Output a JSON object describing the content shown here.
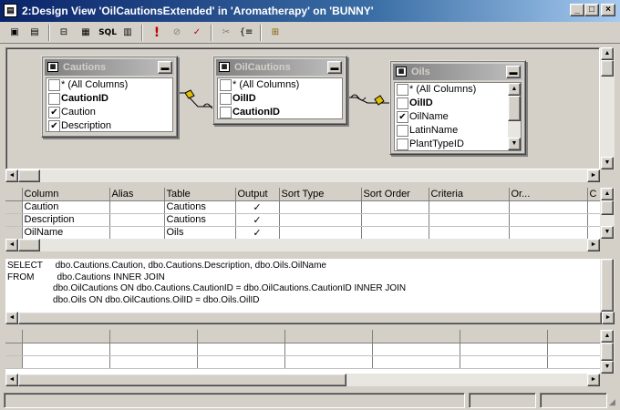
{
  "window": {
    "title": "2:Design View 'OilCautionsExtended' in 'Aromatherapy' on 'BUNNY'",
    "controls": [
      "_",
      "□",
      "×"
    ]
  },
  "toolbar": {
    "items": [
      {
        "name": "save-icon",
        "glyph": "▣"
      },
      {
        "name": "properties-icon",
        "glyph": "▤"
      },
      {
        "name": "diagram-pane-icon",
        "glyph": "⊟"
      },
      {
        "name": "grid-pane-icon",
        "glyph": "▦"
      },
      {
        "name": "sql-pane-icon",
        "glyph": "SQL"
      },
      {
        "name": "results-pane-icon",
        "glyph": "▥"
      },
      {
        "name": "run-icon",
        "glyph": "!"
      },
      {
        "name": "cancel-query-icon",
        "glyph": "⊘"
      },
      {
        "name": "verify-sql-icon",
        "glyph": "✓"
      },
      {
        "name": "remove-filter-icon",
        "glyph": "✂"
      },
      {
        "name": "group-by-icon",
        "glyph": "{≡"
      },
      {
        "name": "add-table-icon",
        "glyph": "⊞"
      }
    ]
  },
  "diagram": {
    "tables": [
      {
        "name": "Cautions",
        "fields": [
          {
            "label": "* (All Columns)",
            "checked": false,
            "bold": false
          },
          {
            "label": "CautionID",
            "checked": false,
            "bold": true
          },
          {
            "label": "Caution",
            "checked": true,
            "bold": false
          },
          {
            "label": "Description",
            "checked": true,
            "bold": false
          }
        ]
      },
      {
        "name": "OilCautions",
        "fields": [
          {
            "label": "* (All Columns)",
            "checked": false,
            "bold": false
          },
          {
            "label": "OilID",
            "checked": false,
            "bold": true
          },
          {
            "label": "CautionID",
            "checked": false,
            "bold": true
          }
        ]
      },
      {
        "name": "Oils",
        "fields": [
          {
            "label": "* (All Columns)",
            "checked": false,
            "bold": false
          },
          {
            "label": "OilID",
            "checked": false,
            "bold": true
          },
          {
            "label": "OilName",
            "checked": true,
            "bold": false
          },
          {
            "label": "LatinName",
            "checked": false,
            "bold": false
          },
          {
            "label": "PlantTypeID",
            "checked": false,
            "bold": false
          }
        ]
      }
    ]
  },
  "grid": {
    "columns": [
      "Column",
      "Alias",
      "Table",
      "Output",
      "Sort Type",
      "Sort Order",
      "Criteria",
      "Or...",
      "C"
    ],
    "rows": [
      {
        "column": "Caution",
        "alias": "",
        "table": "Cautions",
        "output": "✓"
      },
      {
        "column": "Description",
        "alias": "",
        "table": "Cautions",
        "output": "✓"
      },
      {
        "column": "OilName",
        "alias": "",
        "table": "Oils",
        "output": "✓"
      }
    ]
  },
  "sql": {
    "lines": [
      "SELECT     dbo.Cautions.Caution, dbo.Cautions.Description, dbo.Oils.OilName",
      "FROM         dbo.Cautions INNER JOIN",
      "                  dbo.OilCautions ON dbo.Cautions.CautionID = dbo.OilCautions.CautionID INNER JOIN",
      "                  dbo.Oils ON dbo.OilCautions.OilID = dbo.Oils.OilID"
    ]
  },
  "scroll": {
    "up": "▲",
    "down": "▼",
    "left": "◄",
    "right": "►"
  }
}
